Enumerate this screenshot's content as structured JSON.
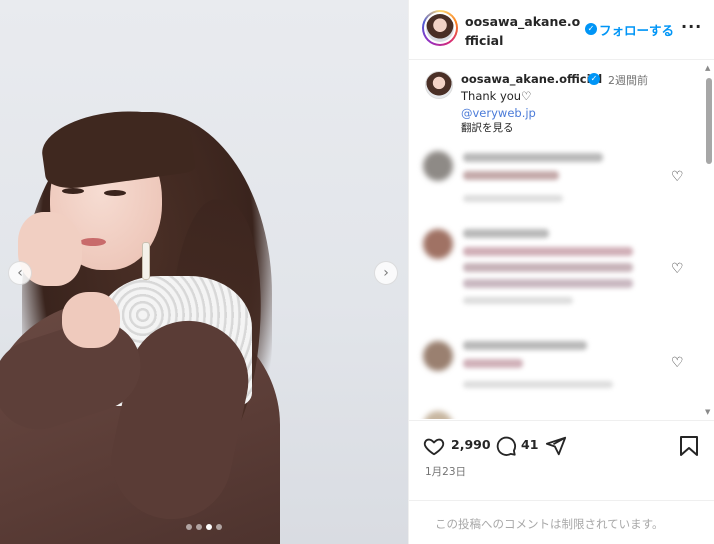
{
  "post": {
    "image_alt": "",
    "nav_prev": "‹",
    "nav_next": "›",
    "carousel_dots": 4,
    "carousel_active_index": 2
  },
  "header": {
    "username": "oosawa_akane.official",
    "verified_icon": "verified-badge-icon",
    "follow_label": "フォローする",
    "more_label": "···"
  },
  "caption": {
    "username": "oosawa_akane.official",
    "time": "2週間前",
    "text": "Thank you♡",
    "link": "@veryweb.jp",
    "translate_label": "翻訳を見る"
  },
  "comments": [
    {
      "avatar_color": "#8e8a86",
      "blurred": true
    },
    {
      "avatar_color": "#a07264",
      "blurred": true
    },
    {
      "avatar_color": "#9a8070",
      "blurred": true
    },
    {
      "avatar_color": "#c7b6a0",
      "blurred": true
    }
  ],
  "scrollbar": {
    "up_icon": "▲",
    "down_icon": "▼"
  },
  "actions": {
    "like_count": "2,990",
    "comment_count": "41",
    "date": "1月23日",
    "icons": [
      "heart-icon",
      "comment-icon",
      "share-icon",
      "save-icon"
    ]
  },
  "footer": {
    "restricted_text": "この投稿へのコメントは制限されています。"
  },
  "colors": {
    "accent_blue": "#0095f6",
    "text": "#262626",
    "muted": "#737373"
  }
}
